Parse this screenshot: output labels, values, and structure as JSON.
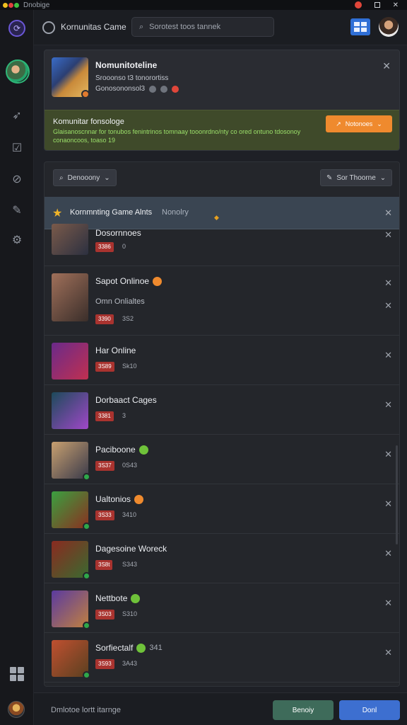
{
  "window": {
    "app_label": "Dnobige"
  },
  "topbar": {
    "title": "Kornunitas Came",
    "search_placeholder": "Sorotest toos tannek"
  },
  "profile_card": {
    "name": "Nomunitoteline",
    "subtitle": "Srooonso t3 tonorortiss",
    "detail": "Gonosononsol3",
    "banner": {
      "title": "Komunitar fonsologe",
      "text": "Glaisanoscnnar for tonubos fenintrinos tomnaay tooonrdno/nty co ored ontuno tdosonoy conaoncoos, toaso 19",
      "button_label": "Notonoes"
    }
  },
  "filters": {
    "sort_label": "Denooony",
    "action_label": "Sor Thoorne"
  },
  "highlight": {
    "title": "Kornmnting Game Alnts",
    "subtitle": "Nonolry"
  },
  "games": [
    {
      "title": "Dosornnoes",
      "tag": "3386",
      "meta": "0",
      "status_icon": "",
      "colors": [
        "#7a5a4a",
        "#2c3040"
      ]
    },
    {
      "title": "Sapot Onlinoe",
      "tag": "3390",
      "meta": "3S2",
      "status_icon": "orange",
      "extra": "Omn Onlialtes",
      "colors": [
        "#a0705a",
        "#3a2e2a"
      ]
    },
    {
      "title": "Har Online",
      "tag": "3S89",
      "meta": "Sk10",
      "status_icon": "",
      "colors": [
        "#6a2a8a",
        "#c03050"
      ]
    },
    {
      "title": "Dorbaact Cages",
      "tag": "3381",
      "meta": "3",
      "status_icon": "",
      "colors": [
        "#1c4a5a",
        "#a048c8"
      ]
    },
    {
      "title": "Paciboone",
      "tag": "3S37",
      "meta": "0S43",
      "status_icon": "green",
      "colors": [
        "#c8a070",
        "#3a3a4a"
      ]
    },
    {
      "title": "Ualtonios",
      "tag": "3S33",
      "meta": "3410",
      "status_icon": "orange",
      "colors": [
        "#3aa040",
        "#8a3020"
      ]
    },
    {
      "title": "Dagesoine Woreck",
      "tag": "3S8t",
      "meta": "S343",
      "status_icon": "",
      "colors": [
        "#8a2a20",
        "#3a6a30"
      ]
    },
    {
      "title": "Nettbote",
      "tag": "3S03",
      "meta": "S310",
      "status_icon": "green",
      "colors": [
        "#5a3aa0",
        "#c08040"
      ]
    },
    {
      "title": "Sorfiectalf",
      "tag": "3S93",
      "meta": "3A43",
      "status_icon": "green",
      "title_suffix": "341",
      "colors": [
        "#c05030",
        "#5a4020"
      ]
    }
  ],
  "footer": {
    "text": "Dmlotoe lortt itarnge",
    "secondary_button": "Benoiy",
    "primary_button": "Donl",
    "colors": {
      "secondary": "#3e6b5a",
      "primary": "#3d6fd0"
    }
  }
}
